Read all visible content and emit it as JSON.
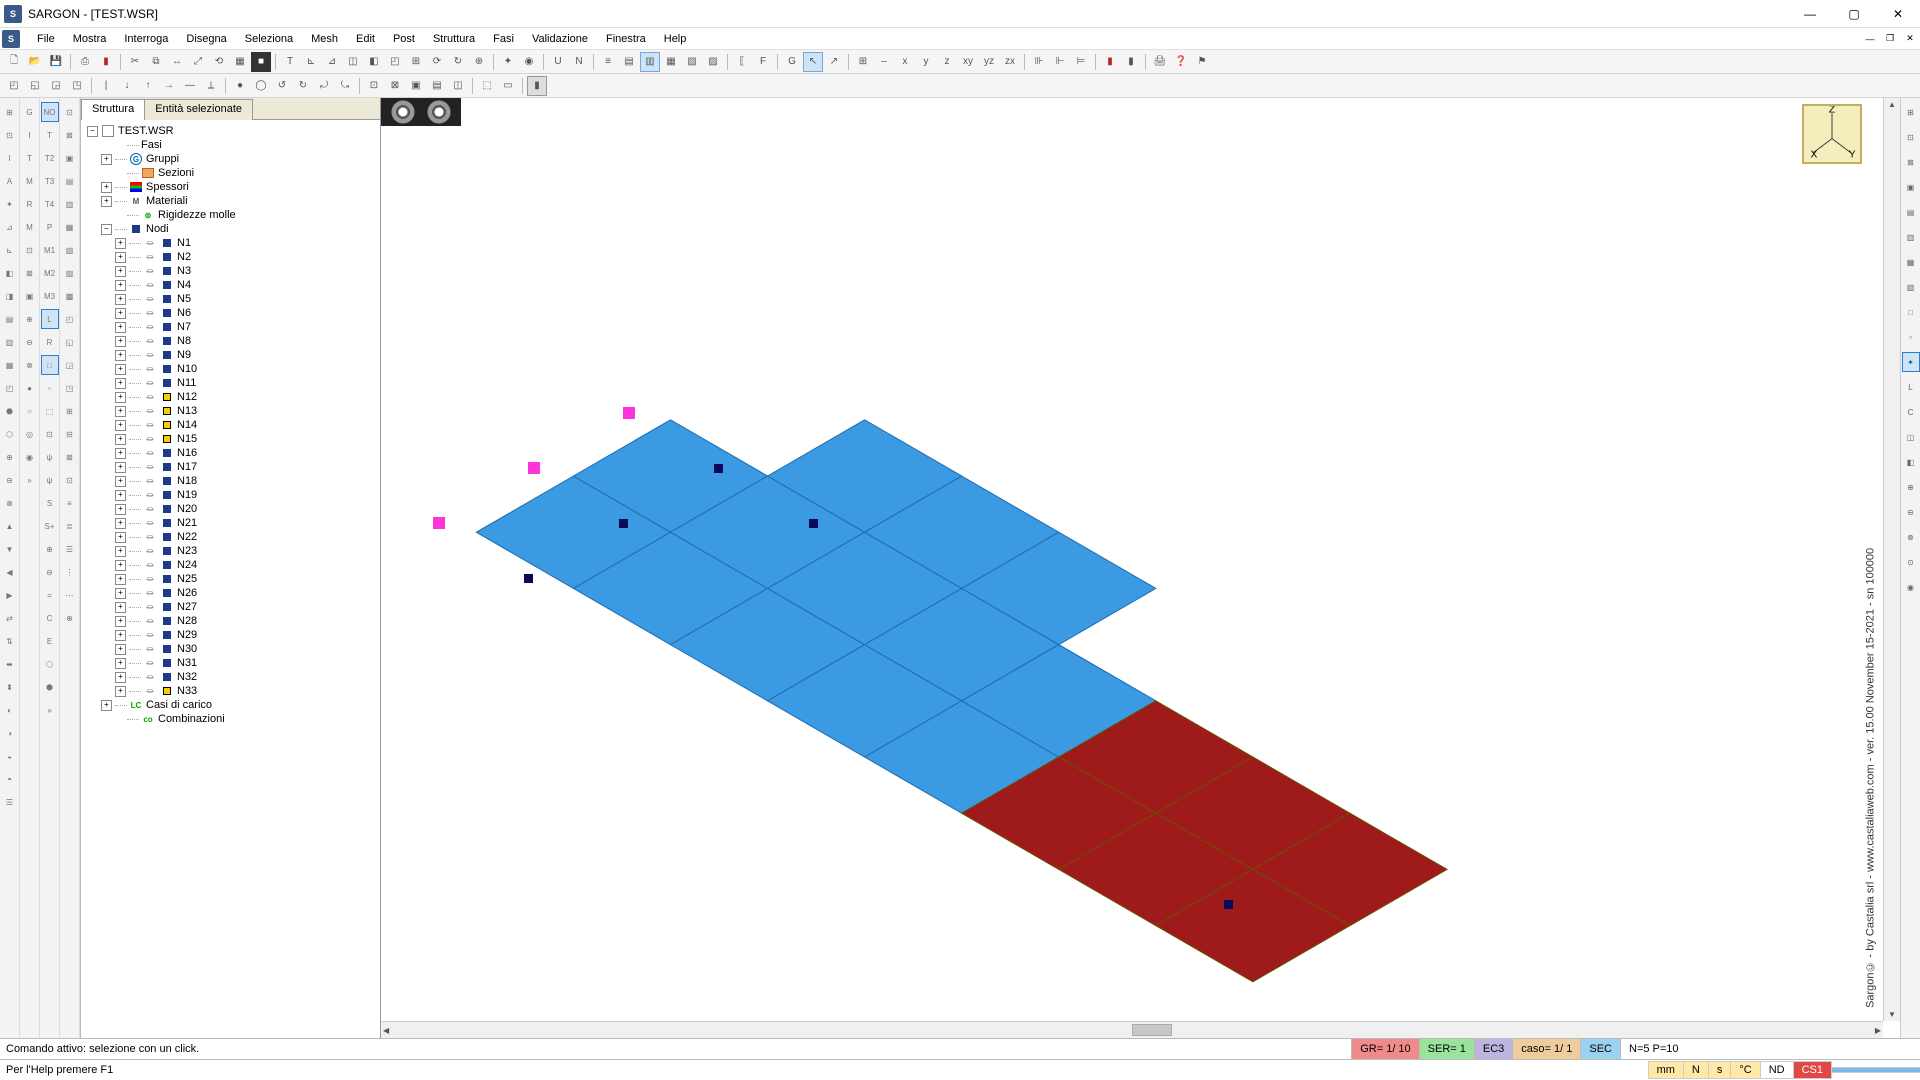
{
  "window": {
    "title": "SARGON - [TEST.WSR]"
  },
  "menus": [
    "File",
    "Mostra",
    "Interroga",
    "Disegna",
    "Seleziona",
    "Mesh",
    "Edit",
    "Post",
    "Struttura",
    "Fasi",
    "Validazione",
    "Finestra",
    "Help"
  ],
  "tabs": {
    "structure": "Struttura",
    "selected": "Entità selezionate"
  },
  "tree": {
    "root": "TEST.WSR",
    "fasi": "Fasi",
    "gruppi": "Gruppi",
    "sezioni": "Sezioni",
    "spessori": "Spessori",
    "materiali": "Materiali",
    "rigidezze": "Rigidezze molle",
    "nodi": "Nodi",
    "casi": "Casi di carico",
    "combinazioni": "Combinazioni",
    "nodes": [
      "N1",
      "N2",
      "N3",
      "N4",
      "N5",
      "N6",
      "N7",
      "N8",
      "N9",
      "N10",
      "N11",
      "N12",
      "N13",
      "N14",
      "N15",
      "N16",
      "N17",
      "N18",
      "N19",
      "N20",
      "N21",
      "N22",
      "N23",
      "N24",
      "N25",
      "N26",
      "N27",
      "N28",
      "N29",
      "N30",
      "N31",
      "N32",
      "N33"
    ],
    "yellow_nodes": [
      "N12",
      "N13",
      "N14",
      "N15",
      "N33"
    ]
  },
  "axis": {
    "x": "X",
    "y": "Y",
    "z": "Z"
  },
  "copyright": "Sargon© - by Castalia srl - www.castaliaweb.com - ver. 15.00 November 15-2021 - sn 100000",
  "status": {
    "cmd": "Comando attivo: selezione con un click.",
    "gr": "GR=   1/ 10",
    "ser": "SER= 1",
    "ec": "EC3",
    "caso": "caso=     1/    1",
    "sec": "SEC",
    "np": "N=5 P=10",
    "help": "Per l'Help premere F1",
    "units": [
      "mm",
      "N",
      "s",
      "°C",
      "ND",
      "CS1"
    ]
  },
  "toolbar1_letters": [
    "U",
    "N",
    "x",
    "y",
    "z",
    "xy",
    "yz",
    "zx",
    "G",
    "SEC"
  ]
}
